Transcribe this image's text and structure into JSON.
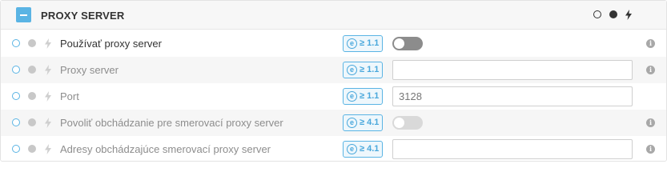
{
  "section": {
    "title": "PROXY SERVER",
    "header_icons": [
      "level-ring-icon",
      "level-dot-icon",
      "level-bolt-icon"
    ]
  },
  "colors": {
    "accent": "#5ab4e4",
    "toggle_on": "#8c8c8c",
    "toggle_disabled": "#d9d9d9"
  },
  "rows": [
    {
      "label": "Používať proxy server",
      "badge": "≥ 1.1",
      "control": "toggle",
      "value": "off"
    },
    {
      "label": "Proxy server",
      "badge": "≥ 1.1",
      "control": "text",
      "value": ""
    },
    {
      "label": "Port",
      "badge": "≥ 1.1",
      "control": "text",
      "value": "3128"
    },
    {
      "label": "Povoliť obchádzanie pre smerovací proxy server",
      "badge": "≥ 4.1",
      "control": "toggle",
      "value": "off"
    },
    {
      "label": "Adresy obchádzajúce smerovací proxy server",
      "badge": "≥ 4.1",
      "control": "text",
      "value": ""
    }
  ],
  "badge_icon": "e",
  "info_icon_glyph": "i"
}
